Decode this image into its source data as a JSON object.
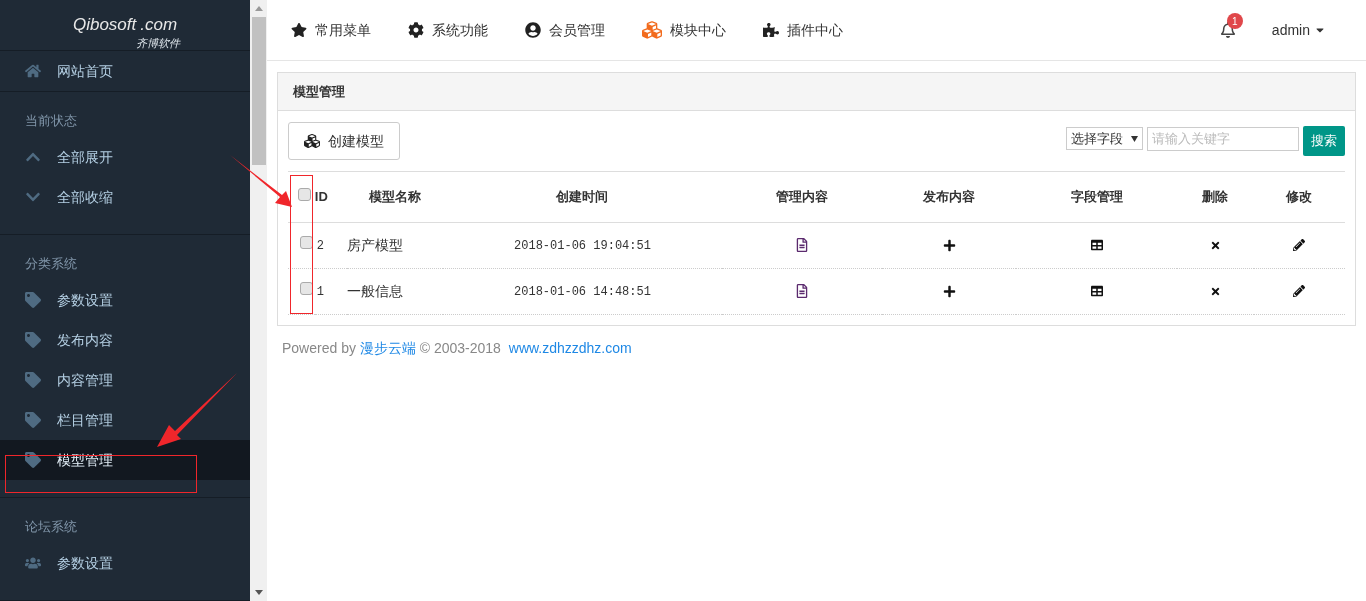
{
  "logo": {
    "name": "Qibosoft",
    "suffix": ".com",
    "tagline": "齐博软件"
  },
  "sidebar": {
    "sections": [
      {
        "items": [
          {
            "label": "网站首页",
            "kind": "home",
            "selected": false
          }
        ]
      },
      {
        "title": "当前状态",
        "items": [
          {
            "label": "全部展开",
            "kind": "expand",
            "selected": false
          },
          {
            "label": "全部收缩",
            "kind": "collapse",
            "selected": false
          }
        ]
      },
      {
        "title": "分类系统",
        "items": [
          {
            "label": "参数设置",
            "kind": "tag",
            "selected": false
          },
          {
            "label": "发布内容",
            "kind": "tag",
            "selected": false
          },
          {
            "label": "内容管理",
            "kind": "tag",
            "selected": false
          },
          {
            "label": "栏目管理",
            "kind": "tag",
            "selected": false
          },
          {
            "label": "模型管理",
            "kind": "tag",
            "selected": true
          }
        ]
      },
      {
        "title": "论坛系统",
        "items": [
          {
            "label": "参数设置",
            "kind": "users",
            "selected": false
          }
        ]
      }
    ]
  },
  "topnav": {
    "items": [
      {
        "label": "常用菜单",
        "kind": "star"
      },
      {
        "label": "系统功能",
        "kind": "gear"
      },
      {
        "label": "会员管理",
        "kind": "user"
      },
      {
        "label": "模块中心",
        "kind": "cubes"
      },
      {
        "label": "插件中心",
        "kind": "puzzle"
      }
    ],
    "notifications": "1",
    "user": "admin"
  },
  "panel": {
    "title": "模型管理",
    "create_button": "创建模型",
    "field_select": "选择字段",
    "search_placeholder": "请输入关键字",
    "search_button": "搜索",
    "columns": [
      "ID",
      "模型名称",
      "创建时间",
      "管理内容",
      "发布内容",
      "字段管理",
      "删除",
      "修改"
    ],
    "header_checked": false,
    "rows": [
      {
        "checked": false,
        "id": "2",
        "name": "房产模型",
        "created": "2018-01-06 19:04:51"
      },
      {
        "checked": false,
        "id": "1",
        "name": "一般信息",
        "created": "2018-01-06 14:48:51"
      }
    ]
  },
  "footer": {
    "prefix": "Powered by",
    "link": "漫步云端",
    "copyright": "© 2003-2018",
    "site": "www.zdhzzdhz.com"
  }
}
